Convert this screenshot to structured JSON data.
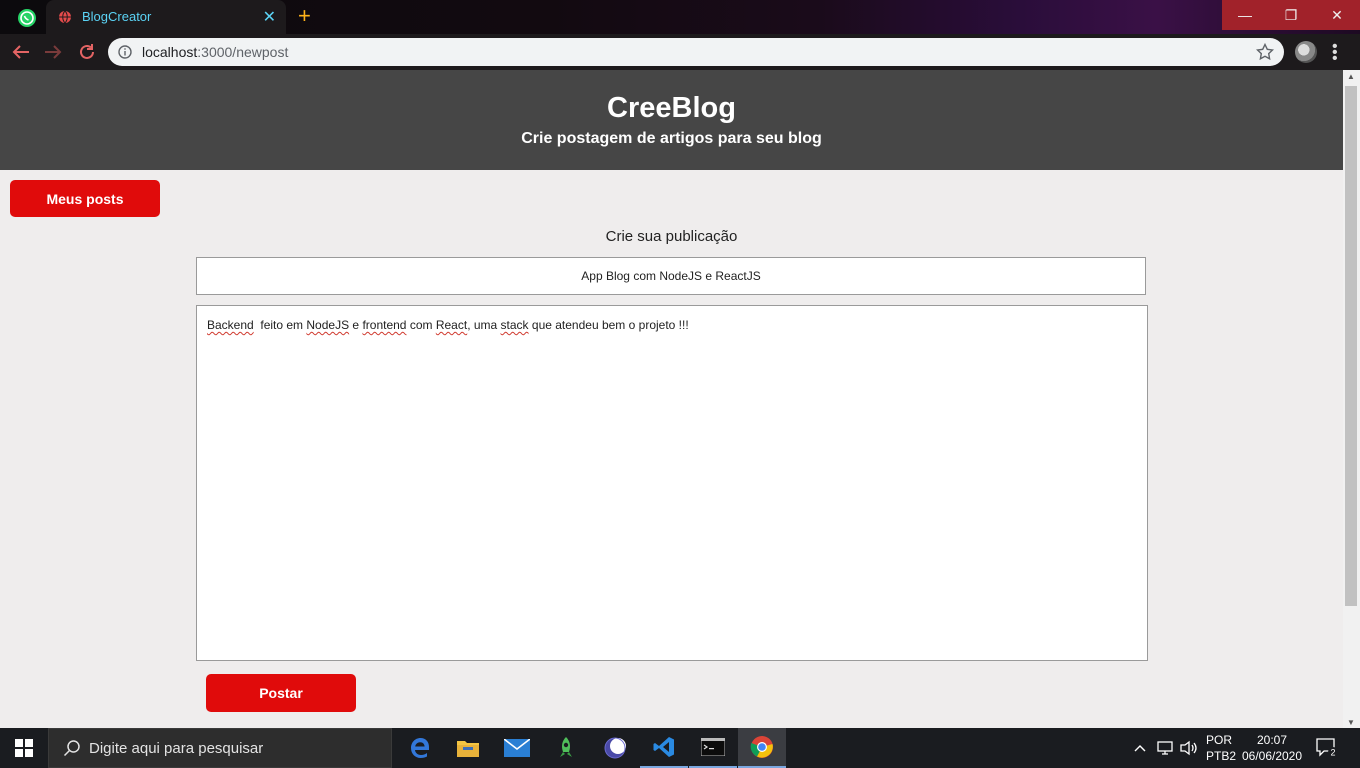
{
  "browser": {
    "tab_title": "BlogCreator",
    "url_host": "localhost",
    "url_path": ":3000/newpost"
  },
  "header": {
    "title": "CreeBlog",
    "subtitle": "Crie postagem de artigos para seu blog"
  },
  "nav": {
    "my_posts_label": "Meus posts"
  },
  "form": {
    "heading": "Crie sua publicação",
    "title_value": "App  Blog com NodeJS e ReactJS",
    "body_words": [
      {
        "t": "Backend",
        "sp": true
      },
      {
        "t": "  feito em ",
        "sp": false
      },
      {
        "t": "NodeJS",
        "sp": true
      },
      {
        "t": " e ",
        "sp": false
      },
      {
        "t": "frontend",
        "sp": true
      },
      {
        "t": " com ",
        "sp": false
      },
      {
        "t": "React",
        "sp": true
      },
      {
        "t": ", uma ",
        "sp": false
      },
      {
        "t": "stack",
        "sp": true
      },
      {
        "t": " que atendeu bem o projeto !!!",
        "sp": false
      }
    ],
    "submit_label": "Postar"
  },
  "taskbar": {
    "search_placeholder": "Digite aqui para pesquisar",
    "lang_top": "POR",
    "lang_bottom": "PTB2",
    "time": "20:07",
    "date": "06/06/2020",
    "notif_count": "2"
  },
  "colors": {
    "accent_red": "#e00b0b",
    "header_bg": "#464646",
    "page_bg": "#efeded"
  }
}
